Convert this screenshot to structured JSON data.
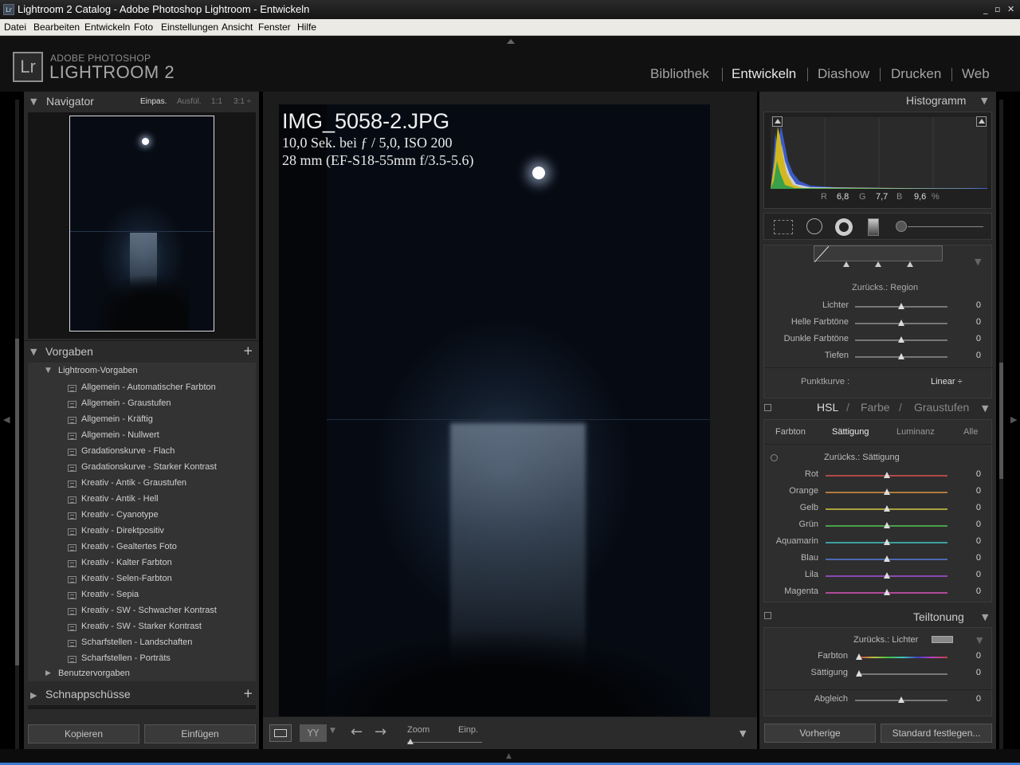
{
  "window": {
    "title": "Lightroom 2 Catalog - Adobe Photoshop Lightroom - Entwickeln",
    "app_icon": "Lr"
  },
  "menu": [
    "Datei",
    "Bearbeiten",
    "Entwickeln",
    "Foto",
    "Einstellungen",
    "Ansicht",
    "Fenster",
    "Hilfe"
  ],
  "brand": {
    "logo": "Lr",
    "line1": "ADOBE PHOTOSHOP",
    "line2": "LIGHTROOM 2"
  },
  "modules": [
    "Bibliothek",
    "Entwickeln",
    "Diashow",
    "Drucken",
    "Web"
  ],
  "active_module": "Entwickeln",
  "navigator": {
    "title": "Navigator",
    "zoom_options": [
      "Einpas.",
      "Ausfül.",
      "1:1",
      "3:1 ÷"
    ],
    "active_zoom": "Einpas."
  },
  "vorgaben": {
    "title": "Vorgaben",
    "add_symbol": "+",
    "group_open": "Lightroom-Vorgaben",
    "items": [
      "Allgemein - Automatischer Farbton",
      "Allgemein - Graustufen",
      "Allgemein - Kräftig",
      "Allgemein - Nullwert",
      "Gradationskurve - Flach",
      "Gradationskurve - Starker Kontrast",
      "Kreativ - Antik - Graustufen",
      "Kreativ - Antik - Hell",
      "Kreativ - Cyanotype",
      "Kreativ - Direktpositiv",
      "Kreativ - Gealtertes Foto",
      "Kreativ - Kalter Farbton",
      "Kreativ - Selen-Farbton",
      "Kreativ - Sepia",
      "Kreativ - SW - Schwacher Kontrast",
      "Kreativ - SW - Starker Kontrast",
      "Scharfstellen - Landschaften",
      "Scharfstellen - Porträts"
    ],
    "group_closed": "Benutzervorgaben"
  },
  "schnappschuesse": {
    "title": "Schnappschüsse",
    "add_symbol": "+"
  },
  "left_buttons": {
    "copy": "Kopieren",
    "paste": "Einfügen"
  },
  "photo_info": {
    "filename": "IMG_5058-2.JPG",
    "exposure": "10,0 Sek. bei ƒ / 5,0, ISO 200",
    "lens": "28 mm (EF-S18-55mm f/3.5-5.6)"
  },
  "toolbar": {
    "zoom_label": "Zoom",
    "zoom_value": "Einp."
  },
  "histogram": {
    "title": "Histogramm",
    "r_label": "R",
    "r_value": "6,8",
    "g_label": "G",
    "g_value": "7,7",
    "b_label": "B",
    "b_value": "9,6",
    "unit": "%"
  },
  "tone_curve": {
    "reset_label": "Zurücks.: Region",
    "sliders": [
      {
        "label": "Lichter",
        "value": "0",
        "position": 0.5
      },
      {
        "label": "Helle Farbtöne",
        "value": "0",
        "position": 0.5
      },
      {
        "label": "Dunkle Farbtöne",
        "value": "0",
        "position": 0.5
      },
      {
        "label": "Tiefen",
        "value": "0",
        "position": 0.5
      }
    ],
    "punktkurve_label": "Punktkurve :",
    "punktkurve_value": "Linear ÷"
  },
  "hsl": {
    "title_hsl": "HSL",
    "title_farbe": "Farbe",
    "title_graustufen": "Graustufen",
    "sep": "/",
    "tabs": [
      "Farbton",
      "Sättigung",
      "Luminanz",
      "Alle"
    ],
    "active_tab": "Sättigung",
    "reset_label": "Zurücks.: Sättigung",
    "sliders": [
      {
        "label": "Rot",
        "value": "0",
        "position": 0.5,
        "color": "#b04848"
      },
      {
        "label": "Orange",
        "value": "0",
        "position": 0.5,
        "color": "#b07a3e"
      },
      {
        "label": "Gelb",
        "value": "0",
        "position": 0.5,
        "color": "#aaa23e"
      },
      {
        "label": "Grün",
        "value": "0",
        "position": 0.5,
        "color": "#4aa04a"
      },
      {
        "label": "Aquamarin",
        "value": "0",
        "position": 0.5,
        "color": "#3ea0a0"
      },
      {
        "label": "Blau",
        "value": "0",
        "position": 0.5,
        "color": "#4a6ab0"
      },
      {
        "label": "Lila",
        "value": "0",
        "position": 0.5,
        "color": "#8a4ab0"
      },
      {
        "label": "Magenta",
        "value": "0",
        "position": 0.5,
        "color": "#b04a9a"
      }
    ]
  },
  "split_toning": {
    "title": "Teiltonung",
    "reset_label": "Zurücks.: Lichter",
    "sliders": [
      {
        "label": "Farbton",
        "value": "0",
        "position": 0.0
      },
      {
        "label": "Sättigung",
        "value": "0",
        "position": 0.0
      }
    ],
    "balance": {
      "label": "Abgleich",
      "value": "0",
      "position": 0.5
    }
  },
  "right_buttons": {
    "previous": "Vorherige",
    "default": "Standard festlegen..."
  }
}
